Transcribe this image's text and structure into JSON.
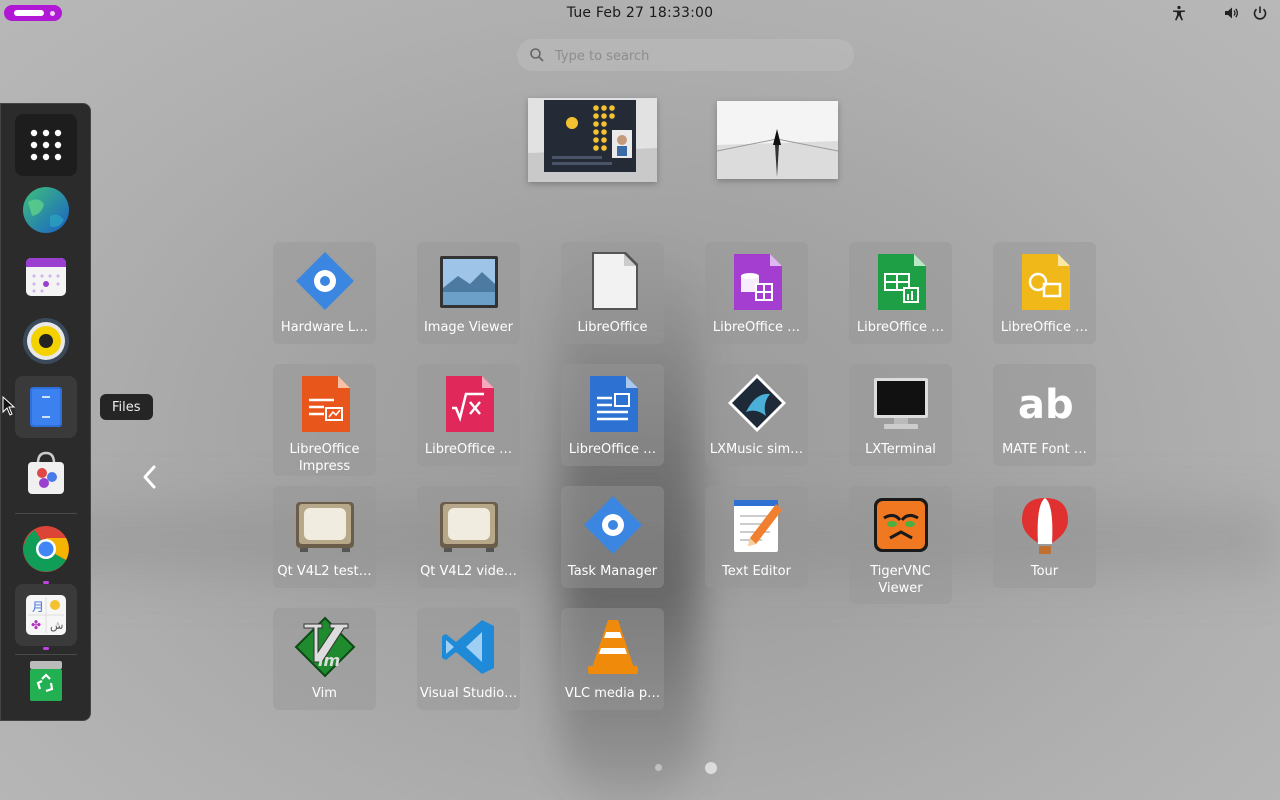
{
  "topbar": {
    "clock": "Tue Feb 27  18:33:00",
    "tray_icons": [
      "accessibility-icon",
      "volume-icon",
      "power-icon"
    ]
  },
  "search": {
    "placeholder": "Type to search",
    "value": ""
  },
  "dock": {
    "items": [
      {
        "name": "show-apps",
        "icon": "grid-icon"
      },
      {
        "name": "browser-globe",
        "icon": "globe-icon"
      },
      {
        "name": "calendar",
        "icon": "calendar-icon"
      },
      {
        "name": "music-player",
        "icon": "speaker-icon"
      },
      {
        "name": "files",
        "icon": "files-icon"
      },
      {
        "name": "software",
        "icon": "bag-icon"
      },
      {
        "name": "google-chrome",
        "icon": "chrome-icon"
      },
      {
        "name": "text-entry",
        "icon": "characters-icon"
      },
      {
        "name": "trash",
        "icon": "trash-icon"
      }
    ],
    "tooltip": "Files"
  },
  "apps": [
    {
      "label": "Hardware L…",
      "icon": "hardware-gear-icon"
    },
    {
      "label": "Image Viewer",
      "icon": "image-viewer-icon"
    },
    {
      "label": "LibreOffice",
      "icon": "libreoffice-icon"
    },
    {
      "label": "LibreOffice …",
      "icon": "libreoffice-base-icon"
    },
    {
      "label": "LibreOffice …",
      "icon": "libreoffice-calc-icon"
    },
    {
      "label": "LibreOffice …",
      "icon": "libreoffice-draw-icon"
    },
    {
      "label": "LibreOffice Impress",
      "icon": "libreoffice-impress-icon"
    },
    {
      "label": "LibreOffice …",
      "icon": "libreoffice-math-icon"
    },
    {
      "label": "LibreOffice …",
      "icon": "libreoffice-writer-icon"
    },
    {
      "label": "LXMusic sim…",
      "icon": "lxmusic-icon"
    },
    {
      "label": "LXTerminal",
      "icon": "terminal-icon"
    },
    {
      "label": "MATE Font …",
      "icon": "font-viewer-icon"
    },
    {
      "label": "Qt V4L2 test…",
      "icon": "qt-v4l2-test-icon"
    },
    {
      "label": "Qt V4L2 vide…",
      "icon": "qt-v4l2-video-icon"
    },
    {
      "label": "Task Manager",
      "icon": "task-manager-icon"
    },
    {
      "label": "Text Editor",
      "icon": "text-editor-icon"
    },
    {
      "label": "TigerVNC Viewer",
      "icon": "tigervnc-icon"
    },
    {
      "label": "Tour",
      "icon": "tour-balloon-icon"
    },
    {
      "label": "Vim",
      "icon": "vim-icon"
    },
    {
      "label": "Visual Studio…",
      "icon": "vscode-icon"
    },
    {
      "label": "VLC media p…",
      "icon": "vlc-icon"
    }
  ],
  "pagination": {
    "pages": 2,
    "current": 2
  },
  "colors": {
    "accent": "#b018d6",
    "dock_bg": "#2b2b2b"
  }
}
